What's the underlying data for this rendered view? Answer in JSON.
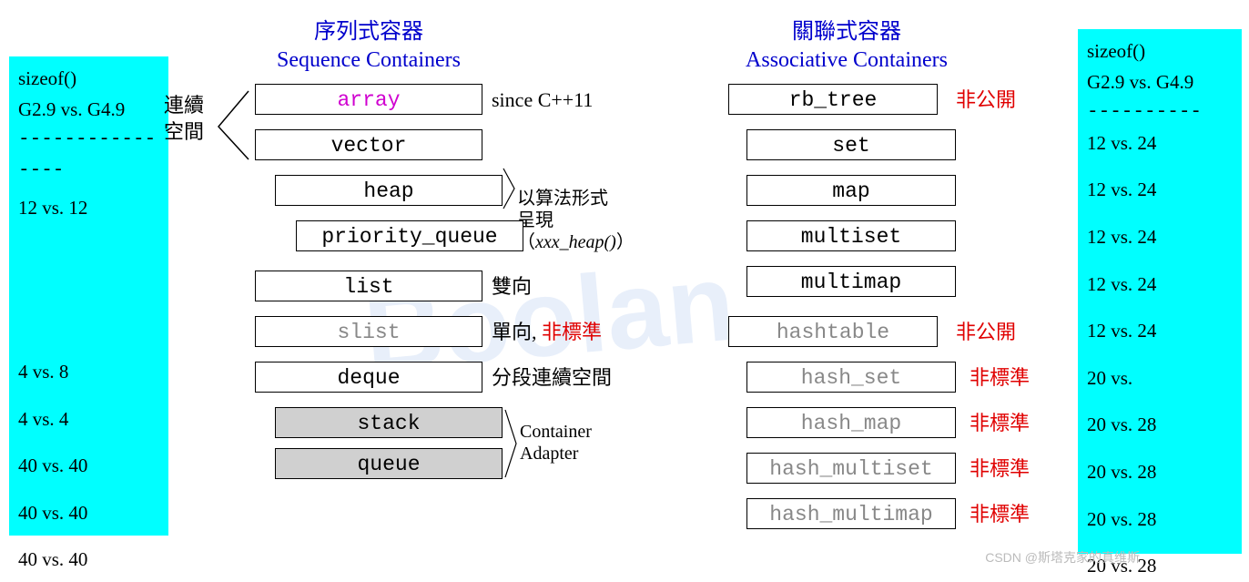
{
  "left_sizes": {
    "title1": "sizeof()",
    "title2": "G2.9 vs. G4.9",
    "dash": "----------------",
    "rows": [
      "12 vs. 12",
      "",
      "",
      "4   vs. 8",
      "4   vs. 4",
      "40 vs. 40",
      "40 vs. 40",
      "40 vs. 40"
    ]
  },
  "right_sizes": {
    "title1": "sizeof()",
    "title2": "G2.9 vs. G4.9",
    "dash": "----------",
    "rows": [
      "12 vs. 24",
      "12 vs. 24",
      "12 vs. 24",
      "12 vs. 24",
      "12 vs. 24",
      "20 vs.",
      "20 vs. 28",
      "20 vs. 28",
      "20 vs. 28",
      "20 vs. 28"
    ]
  },
  "seq": {
    "header_cn": "序列式容器",
    "header_en": "Sequence Containers",
    "left_label": "連續\n空間",
    "rows": {
      "array": {
        "label": "array",
        "note": "since C++11"
      },
      "vector": {
        "label": "vector"
      },
      "heap": {
        "label": "heap",
        "note": "以算法形式\n呈現（xxx_heap()）"
      },
      "priority_queue": {
        "label": "priority_queue"
      },
      "list": {
        "label": "list",
        "note": "雙向"
      },
      "slist": {
        "label": "slist",
        "note1": "單向,",
        "note2": "非標準"
      },
      "deque": {
        "label": "deque",
        "note": "分段連續空間"
      },
      "stack": {
        "label": "stack"
      },
      "queue": {
        "label": "queue"
      }
    },
    "adapter_note": "Container\nAdapter"
  },
  "assoc": {
    "header_cn": "關聯式容器",
    "header_en": "Associative Containers",
    "rows": {
      "rb_tree": {
        "label": "rb_tree",
        "note": "非公開"
      },
      "set": {
        "label": "set"
      },
      "map": {
        "label": "map"
      },
      "multiset": {
        "label": "multiset"
      },
      "multimap": {
        "label": "multimap"
      },
      "hashtable": {
        "label": "hashtable",
        "note": "非公開"
      },
      "hash_set": {
        "label": "hash_set",
        "note": "非標準"
      },
      "hash_map": {
        "label": "hash_map",
        "note": "非標準"
      },
      "hash_multiset": {
        "label": "hash_multiset",
        "note": "非標準"
      },
      "hash_multimap": {
        "label": "hash_multimap",
        "note": "非標準"
      }
    }
  },
  "watermark": "Boolan",
  "csdn": "CSDN @斯塔克家的真维斯"
}
